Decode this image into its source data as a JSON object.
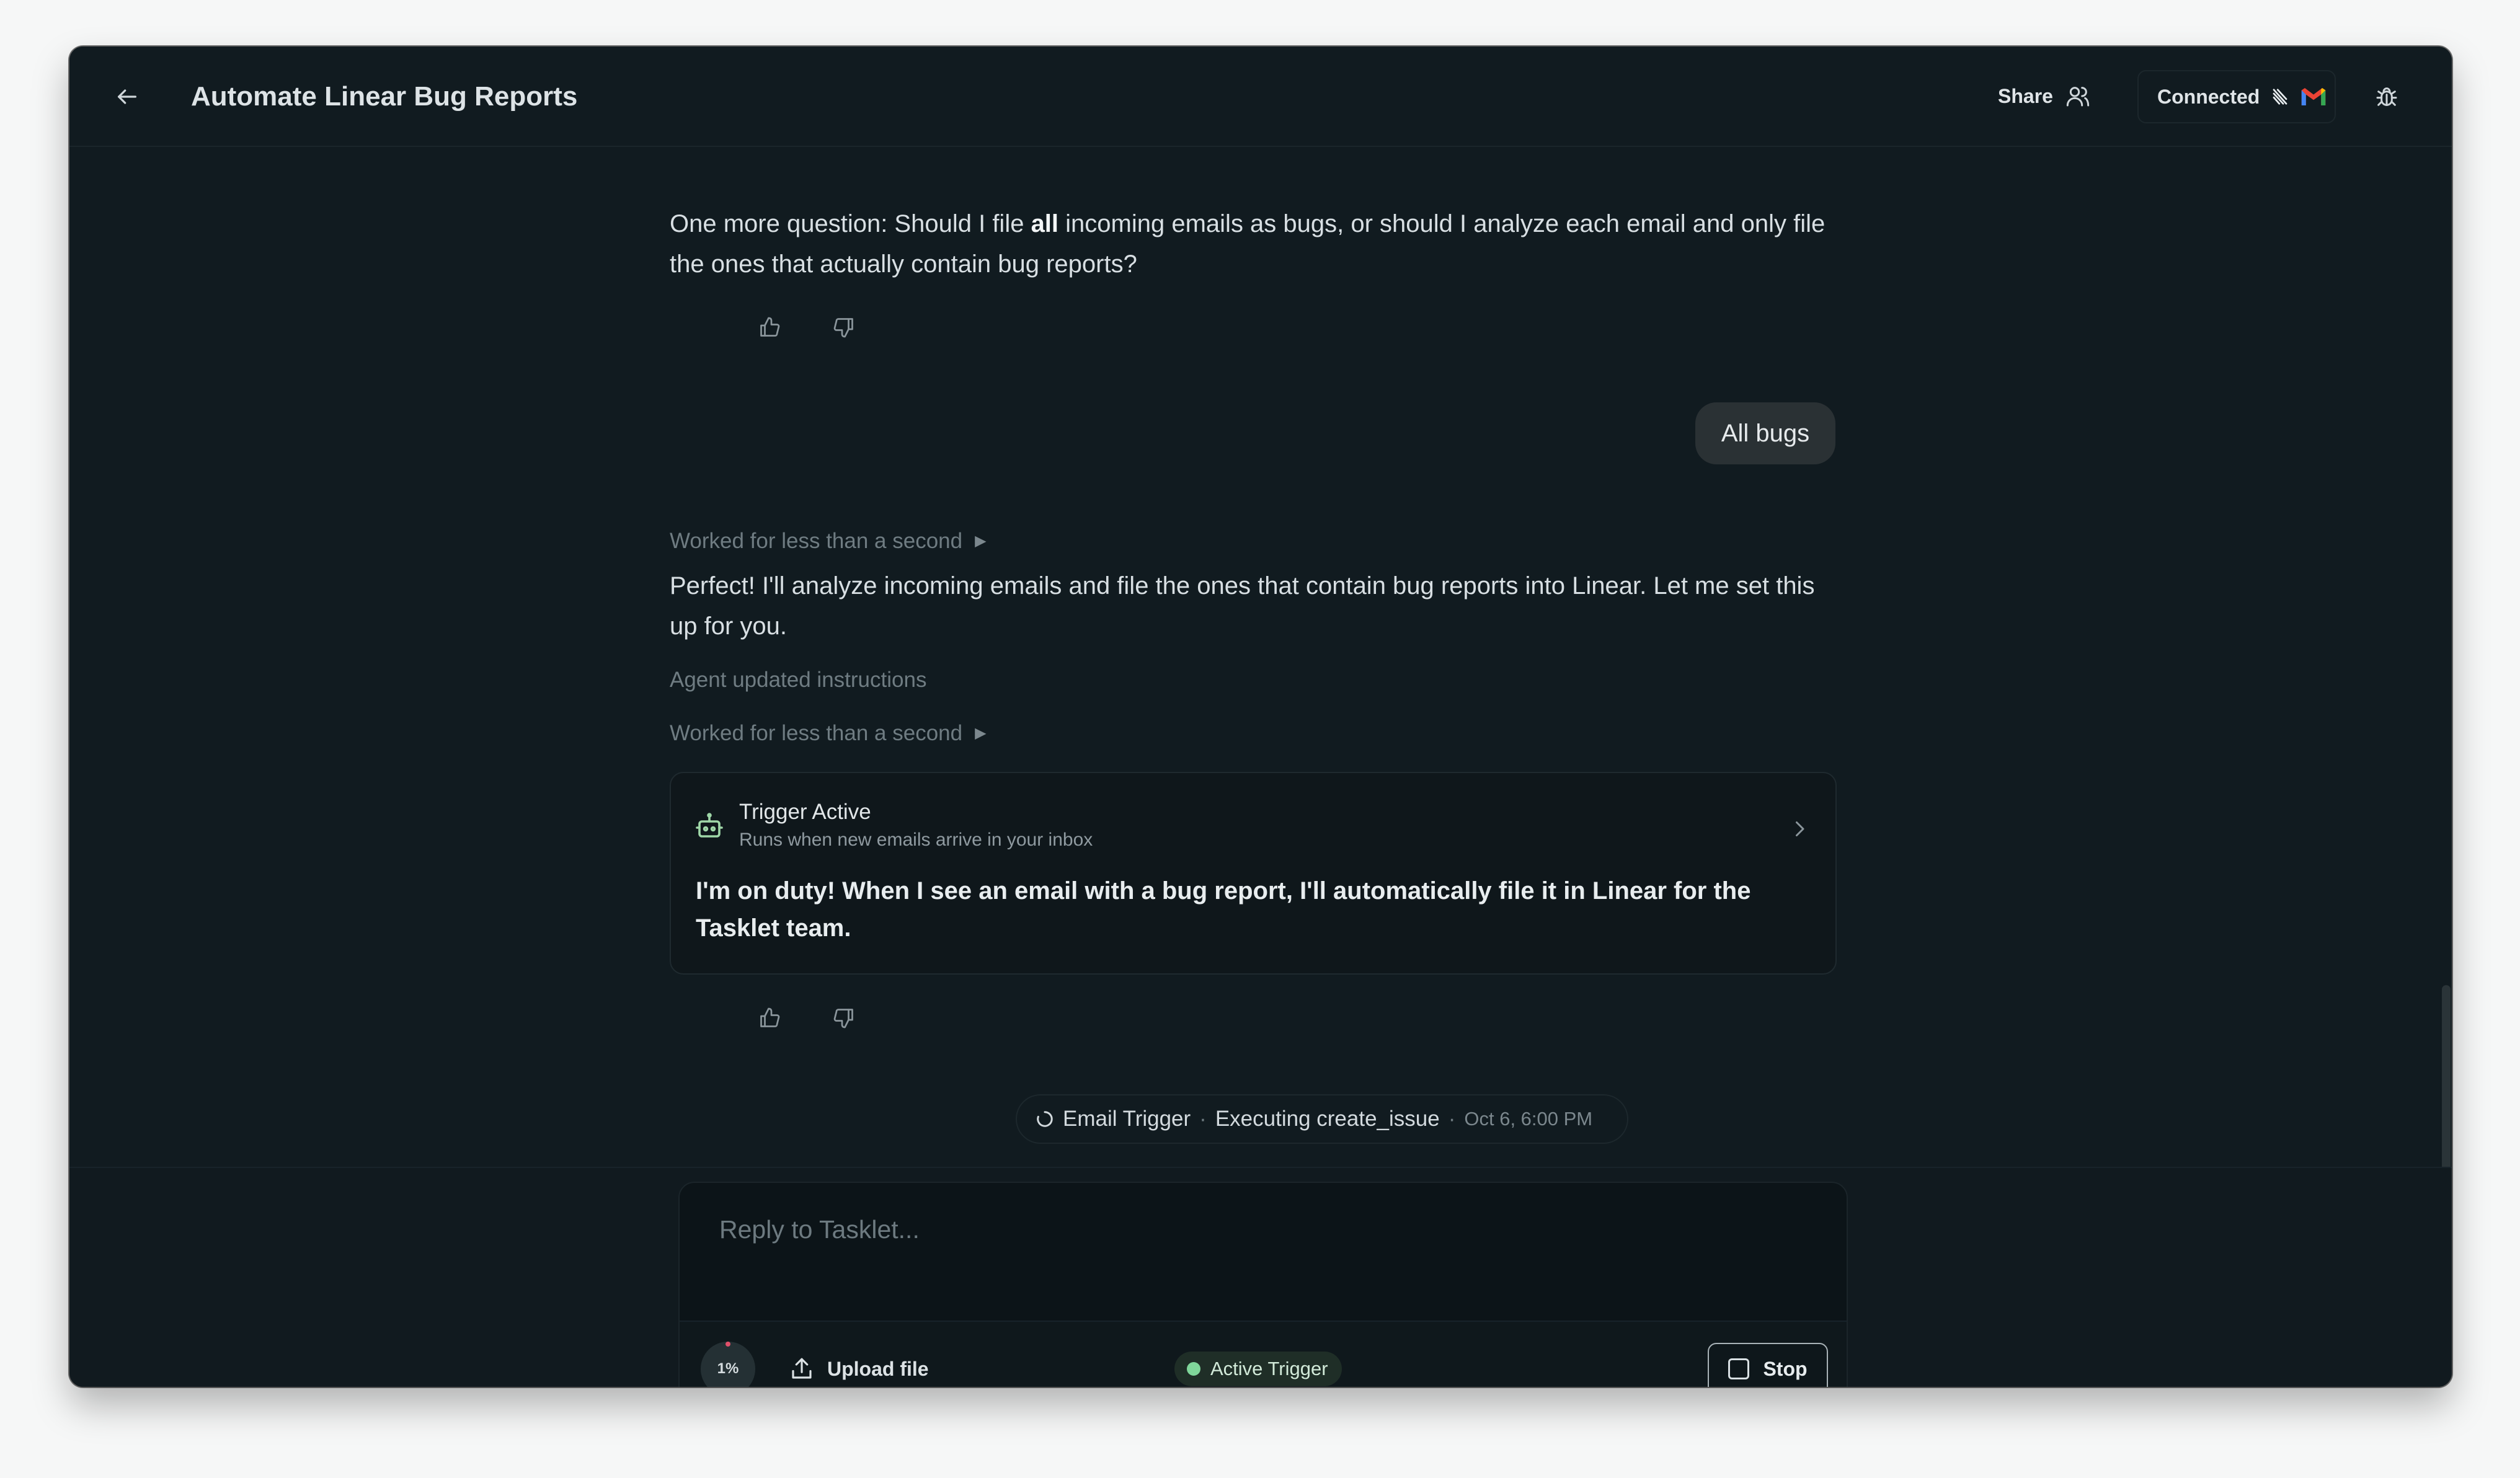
{
  "header": {
    "title": "Automate Linear Bug Reports",
    "share_label": "Share",
    "connected_label": "Connected"
  },
  "conversation": {
    "question_pre": "One more question: Should I file ",
    "question_bold": "all",
    "question_post": " incoming emails as bugs, or should I analyze each email and only file the ones that actually contain bug reports?",
    "user_reply": "All bugs",
    "worked_1": "Worked for less than a second",
    "agent_reply": "Perfect! I'll analyze incoming emails and file the ones that contain bug reports into Linear. Let me set this up for you.",
    "agent_updated": "Agent updated instructions",
    "worked_2": "Worked for less than a second",
    "trigger_card": {
      "title": "Trigger Active",
      "subtitle": "Runs when new emails arrive in your inbox",
      "body": "I'm on duty! When I see an email with a bug report, I'll automatically file it in Linear for the Tasklet team."
    },
    "status": {
      "trigger": "Email Trigger",
      "separator": "·",
      "action": "Executing create_issue",
      "time": "Oct 6, 6:00 PM"
    }
  },
  "composer": {
    "placeholder": "Reply to Tasklet...",
    "usage": "1%",
    "upload_label": "Upload file",
    "active_trigger_label": "Active Trigger",
    "stop_label": "Stop"
  },
  "icons": {
    "back": "arrow-left-icon",
    "share": "users-icon",
    "bug": "bug-icon",
    "thumbs_up": "thumbs-up-icon",
    "thumbs_down": "thumbs-down-icon",
    "robot": "robot-icon",
    "chevron": "chevron-right-icon",
    "spinner": "spinner-icon",
    "upload": "upload-icon",
    "stop": "stop-square-icon"
  },
  "colors": {
    "background": "#111b20",
    "accent_green": "#7fd69a",
    "gmail_red": "#ea4335"
  }
}
